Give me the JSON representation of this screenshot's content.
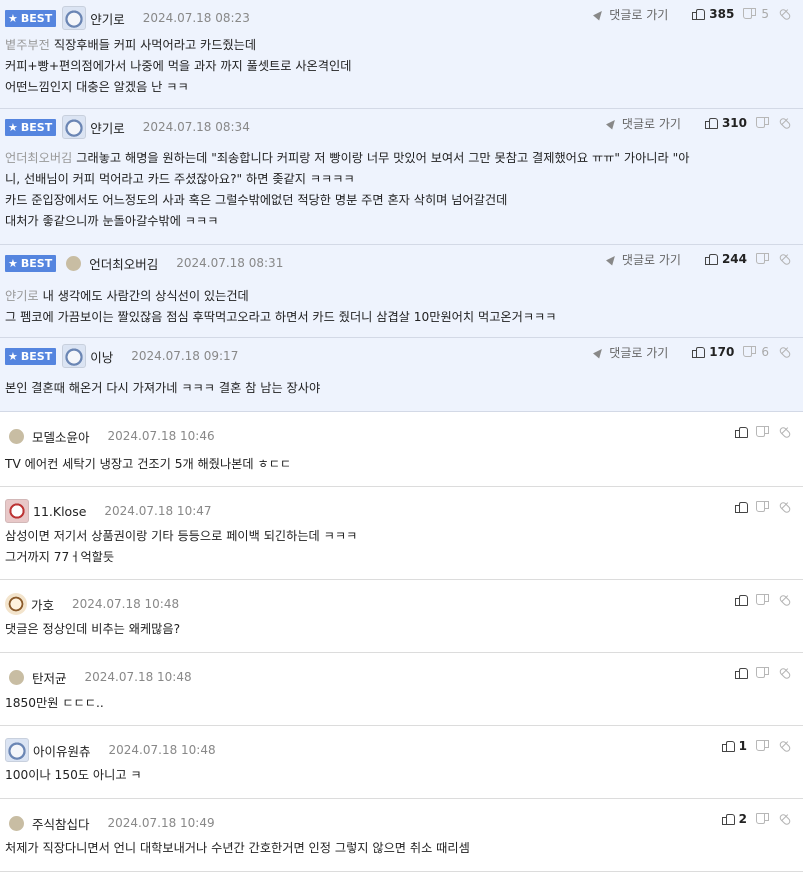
{
  "labels": {
    "best": "BEST",
    "goto_reply": "댓글로 가기"
  },
  "comments": [
    {
      "best": true,
      "avatar": "avatar-pic",
      "nick": "얀기로",
      "date": "2024.07.18 08:23",
      "up": "385",
      "down": "5",
      "mention": "볕주부전",
      "lines": [
        "직장후배들 커피 사먹어라고 카드줬는데",
        "커피+빵+편의점에가서 나중에 먹을 과자 까지 풀셋트로 사온격인데",
        "어떤느낌인지 대충은 알겠음 난 ㅋㅋ"
      ]
    },
    {
      "best": true,
      "avatar": "avatar-pic",
      "nick": "얀기로",
      "date": "2024.07.18 08:34",
      "up": "310",
      "down": "",
      "mention": "언더최오버김",
      "lines": [
        "그래놓고 해명을 원하는데 \"죄송합니다 커피랑 저 빵이랑 너무 맛있어 보여서 그만 못참고 결제했어요 ㅠㅠ\" 가아니라 \"아",
        "니, 선배님이 커피 먹어라고 카드 주셨잖아요?\" 하면 좆같지 ㅋㅋㅋㅋ",
        "카드 준입장에서도 어느정도의 사과 혹은 그럴수밖에없던 적당한 명분 주면 혼자 삭히며 넘어갈건데",
        "대처가 좋같으니까 눈돌아갈수밖에 ㅋㅋㅋ"
      ]
    },
    {
      "best": true,
      "avatar": "avatar-dot",
      "nick": "언더최오버김",
      "date": "2024.07.18 08:31",
      "up": "244",
      "down": "",
      "mention": "얀기로",
      "lines": [
        "내 생각에도 사람간의 상식선이 있는건데",
        "그 펨코에 가끔보이는 짤있잖음 점심 후딱먹고오라고 하면서 카드 줬더니 삼겹살 10만원어치 먹고온거ㅋㅋㅋ"
      ]
    },
    {
      "best": true,
      "avatar": "avatar-pic",
      "nick": "이낭",
      "date": "2024.07.18 09:17",
      "up": "170",
      "down": "6",
      "mention": "",
      "lines": [
        "본인 결혼때 해온거 다시 가져가네 ㅋㅋㅋ 결혼 참 남는 장사야"
      ]
    },
    {
      "best": false,
      "avatar": "avatar-dot",
      "nick": "모델소윤아",
      "date": "2024.07.18 10:46",
      "up": "",
      "down": "",
      "mention": "",
      "lines": [
        "TV 에어컨 세탁기 냉장고 건조기 5개 해줬나본데 ㅎㄷㄷ"
      ]
    },
    {
      "best": false,
      "avatar": "avatar-dog",
      "nick": "11.Klose",
      "date": "2024.07.18 10:47",
      "up": "",
      "down": "",
      "mention": "",
      "lines": [
        "삼성이면 저기서 상품권이랑 기타 등등으로 페이백 되긴하는데 ㅋㅋㅋ",
        "그거까지 77ㅓ억할듯"
      ]
    },
    {
      "best": false,
      "avatar": "avatar-pup",
      "nick": "가호",
      "date": "2024.07.18 10:48",
      "up": "",
      "down": "",
      "mention": "",
      "lines": [
        "댓글은 정상인데 비추는 왜케많음?"
      ]
    },
    {
      "best": false,
      "avatar": "avatar-dot",
      "nick": "탄저균",
      "date": "2024.07.18 10:48",
      "up": "",
      "down": "",
      "mention": "",
      "lines": [
        "1850만원 ㄷㄷㄷ.."
      ]
    },
    {
      "best": false,
      "avatar": "avatar-pic",
      "nick": "아이유원츄",
      "date": "2024.07.18 10:48",
      "up": "1",
      "down": "",
      "mention": "",
      "lines": [
        "100이나 150도 아니고 ㅋ"
      ]
    },
    {
      "best": false,
      "avatar": "avatar-dot",
      "nick": "주식참십다",
      "date": "2024.07.18 10:49",
      "up": "2",
      "down": "",
      "mention": "",
      "lines": [
        "처제가 직장다니면서 언니 대학보내거나 수년간 간호한거면 인정 그렇지 않으면 취소 때리셈"
      ]
    }
  ]
}
